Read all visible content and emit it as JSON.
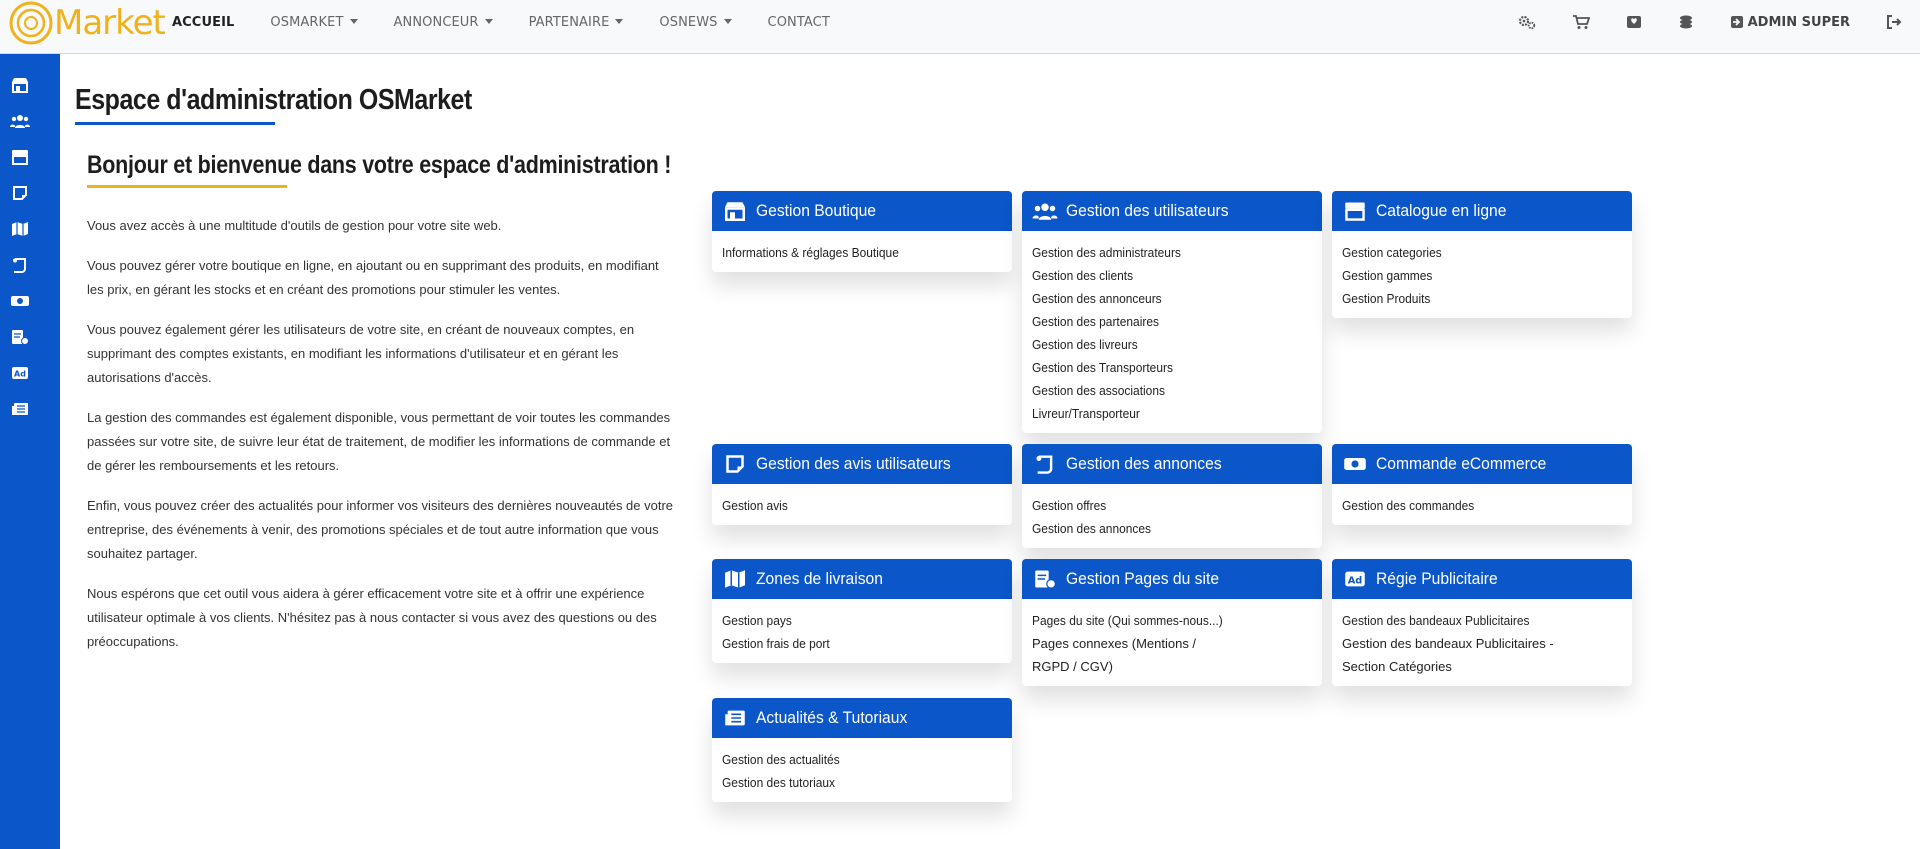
{
  "brand": {
    "name": "Market"
  },
  "nav": {
    "items": [
      {
        "label": "ACCUEIL"
      },
      {
        "label": "OSMARKET"
      },
      {
        "label": "ANNONCEUR"
      },
      {
        "label": "PARTENAIRE"
      },
      {
        "label": "OSNEWS"
      },
      {
        "label": "CONTACT"
      }
    ],
    "right": {
      "icons": [
        "gears-icon",
        "cart-icon",
        "shield-icon",
        "coins-icon"
      ],
      "admin_label": "ADMIN SUPER"
    }
  },
  "sidebar": {
    "icons": [
      "store-icon",
      "users-icon",
      "store-front-icon",
      "note-icon",
      "map-icon",
      "scroll-icon",
      "money-icon",
      "page-check-icon",
      "ad-icon",
      "newspaper-icon"
    ]
  },
  "page": {
    "title": "Espace d'administration OSMarket",
    "welcome": "Bonjour et bienvenue dans votre espace d'administration !",
    "paragraphs": [
      "Vous avez accès à une multitude d'outils de gestion pour votre site web.",
      "Vous pouvez gérer votre boutique en ligne, en ajoutant ou en supprimant des produits, en modifiant les prix, en gérant les stocks et en créant des promotions pour stimuler les ventes.",
      "Vous pouvez également gérer les utilisateurs de votre site, en créant de nouveaux comptes, en supprimant des comptes existants, en modifiant les informations d'utilisateur et en gérant les autorisations d'accès.",
      "La gestion des commandes est également disponible, vous permettant de voir toutes les commandes passées sur votre site, de suivre leur état de traitement, de modifier les informations de commande et de gérer les remboursements et les retours.",
      "Enfin, vous pouvez créer des actualités pour informer vos visiteurs des dernières nouveautés de votre entreprise, des événements à venir, des promotions spéciales et de tout autre information que vous souhaitez partager.",
      "Nous espérons que cet outil vous aidera à gérer efficacement votre site et à offrir une expérience utilisateur optimale à vos clients. N'hésitez pas à nous contacter si vous avez des questions ou des préoccupations."
    ]
  },
  "cards": [
    {
      "title": "Gestion Boutique",
      "icon": "store-icon",
      "links": [
        "Informations & réglages Boutique"
      ]
    },
    {
      "title": "Gestion des utilisateurs",
      "icon": "users-icon",
      "links": [
        "Gestion des administrateurs",
        "Gestion des clients",
        "Gestion des annonceurs",
        "Gestion des partenaires",
        "Gestion des livreurs",
        "Gestion des Transporteurs",
        "Gestion des associations",
        "Livreur/Transporteur"
      ]
    },
    {
      "title": "Catalogue en ligne",
      "icon": "store-front-icon",
      "links": [
        "Gestion categories",
        "Gestion gammes",
        "Gestion Produits"
      ]
    },
    {
      "title": "Gestion des avis utilisateurs",
      "icon": "note-icon",
      "links": [
        "Gestion avis"
      ]
    },
    {
      "title": "Gestion des annonces",
      "icon": "scroll-icon",
      "links": [
        "Gestion offres",
        "Gestion des annonces"
      ]
    },
    {
      "title": "Commande eCommerce",
      "icon": "money-icon",
      "links": [
        "Gestion des commandes"
      ]
    },
    {
      "title": "Zones de livraison",
      "icon": "map-icon",
      "links": [
        "Gestion pays",
        "Gestion frais de port"
      ]
    },
    {
      "title": "Gestion Pages du site",
      "icon": "page-check-icon",
      "links": [
        "Pages du site (Qui sommes-nous...)",
        "Pages connexes (Mentions / RGPD / CGV)"
      ]
    },
    {
      "title": "Régie Publicitaire",
      "icon": "ad-icon",
      "links": [
        "Gestion des bandeaux Publicitaires",
        "Gestion des bandeaux Publicitaires - Section Catégories"
      ]
    },
    {
      "title": "Actualités & Tutoriaux",
      "icon": "newspaper-icon",
      "links": [
        "Gestion des actualités",
        "Gestion des tutoriaux"
      ]
    }
  ],
  "colors": {
    "primary": "#0b56c8",
    "accent": "#f0b21c"
  }
}
